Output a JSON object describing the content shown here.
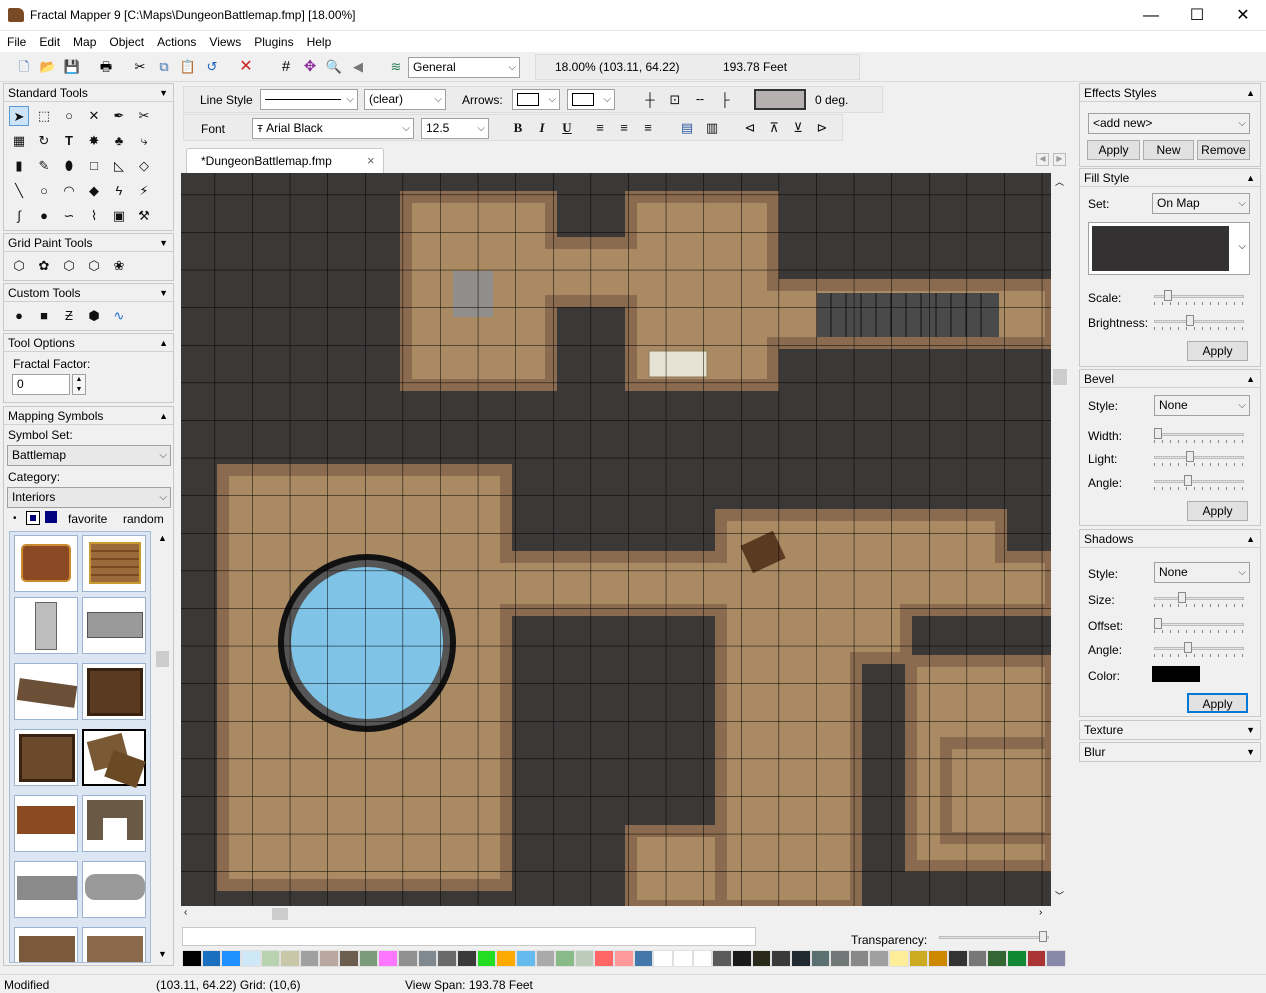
{
  "window": {
    "title": "Fractal Mapper 9 [C:\\Maps\\DungeonBattlemap.fmp] [18.00%]",
    "minimize": "—",
    "maximize": "☐",
    "close": "✕"
  },
  "menu": [
    "File",
    "Edit",
    "Map",
    "Object",
    "Actions",
    "Views",
    "Plugins",
    "Help"
  ],
  "toolbar": {
    "layer": "General",
    "zoom_coords": "18.00%  (103.11, 64.22)",
    "distance": "193.78 Feet"
  },
  "format_bar": {
    "line_style_label": "Line Style",
    "fill_value": "(clear)",
    "arrows_label": "Arrows:",
    "angle": "0 deg.",
    "font_label": "Font",
    "font_value": "Arial Black",
    "font_size": "12.5",
    "bold": "B",
    "italic": "I",
    "underline": "U"
  },
  "tab": {
    "filename": "*DungeonBattlemap.fmp",
    "close": "×"
  },
  "left": {
    "standard_tools": "Standard Tools",
    "grid_paint_tools": "Grid Paint Tools",
    "custom_tools": "Custom Tools",
    "tool_options": "Tool Options",
    "fractal_factor_label": "Fractal Factor:",
    "fractal_factor_value": "0",
    "mapping_symbols": "Mapping Symbols",
    "symbol_set_label": "Symbol Set:",
    "symbol_set_value": "Battlemap",
    "category_label": "Category:",
    "category_value": "Interiors",
    "favorite": "favorite",
    "random": "random"
  },
  "right": {
    "effects_styles": "Effects Styles",
    "add_new": "<add new>",
    "apply": "Apply",
    "new": "New",
    "remove": "Remove",
    "fill_style": "Fill Style",
    "set_label": "Set:",
    "set_value": "On Map",
    "scale_label": "Scale:",
    "brightness_label": "Brightness:",
    "bevel": "Bevel",
    "style_label": "Style:",
    "bevel_style": "None",
    "width_label": "Width:",
    "light_label": "Light:",
    "angle_label": "Angle:",
    "shadows": "Shadows",
    "shadow_style": "None",
    "size_label": "Size:",
    "offset_label": "Offset:",
    "color_label": "Color:",
    "texture": "Texture",
    "blur": "Blur"
  },
  "palette": {
    "transparency_label": "Transparency:",
    "colors": [
      "#000000",
      "#1a6fbf",
      "#1e90ff",
      "#cfe8f7",
      "#b9d3b0",
      "#c8c8a8",
      "#a0a0a0",
      "#b8a8a0",
      "#6b5e4f",
      "#7a9a7a",
      "#ff77ff",
      "#909090",
      "#808890",
      "#6a6a6a",
      "#3a3a3a",
      "#22dd22",
      "#ffaa00",
      "#66bbee",
      "#aaaaaa",
      "#88bb88",
      "#bbccbb",
      "#ff6666",
      "#ff9999",
      "#4477aa",
      "#ffffff",
      "#ffffff",
      "#ffffff",
      "#5a5a5a",
      "#1a1a1a",
      "#2a2a1a",
      "#3a3a3a",
      "#202830",
      "#5a7070",
      "#707878",
      "#888888",
      "#a0a0a0",
      "#ffee99",
      "#ccaa22",
      "#cc8800",
      "#333333",
      "#777777",
      "#336633",
      "#118833",
      "#aa3333",
      "#8888aa"
    ]
  },
  "status": {
    "state": "Modified",
    "coords": "(103.11, 64.22) Grid: (10,6)",
    "view_span": "View Span: 193.78 Feet"
  }
}
